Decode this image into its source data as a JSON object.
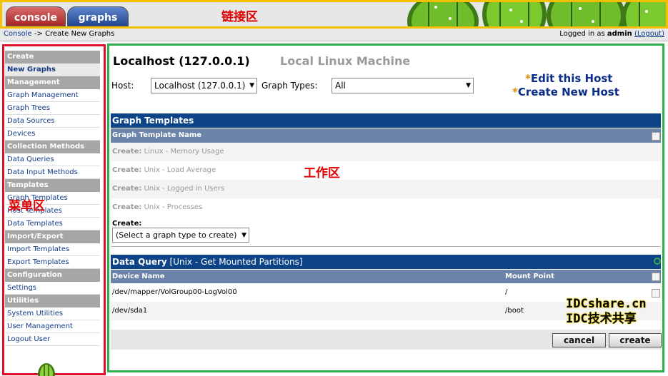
{
  "tabs": [
    {
      "label": "console"
    },
    {
      "label": "graphs"
    }
  ],
  "annotations": {
    "link_zone": "链接区",
    "menu_zone": "菜单区",
    "work_zone": "工作区"
  },
  "breadcrumb": {
    "root": "Console",
    "separator": " -> ",
    "current": "Create New Graphs"
  },
  "login": {
    "prefix": "Logged in as ",
    "user": "admin",
    "logout": "(Logout)"
  },
  "sidebar": {
    "items": [
      {
        "type": "header",
        "label": "Create"
      },
      {
        "type": "item",
        "label": "New Graphs",
        "selected": true
      },
      {
        "type": "header",
        "label": "Management"
      },
      {
        "type": "item",
        "label": "Graph Management"
      },
      {
        "type": "item",
        "label": "Graph Trees"
      },
      {
        "type": "item",
        "label": "Data Sources"
      },
      {
        "type": "item",
        "label": "Devices"
      },
      {
        "type": "header",
        "label": "Collection Methods"
      },
      {
        "type": "item",
        "label": "Data Queries"
      },
      {
        "type": "item",
        "label": "Data Input Methods"
      },
      {
        "type": "header",
        "label": "Templates"
      },
      {
        "type": "item",
        "label": "Graph Templates"
      },
      {
        "type": "item",
        "label": "Host Templates"
      },
      {
        "type": "item",
        "label": "Data Templates"
      },
      {
        "type": "header",
        "label": "Import/Export"
      },
      {
        "type": "item",
        "label": "Import Templates"
      },
      {
        "type": "item",
        "label": "Export Templates"
      },
      {
        "type": "header",
        "label": "Configuration"
      },
      {
        "type": "item",
        "label": "Settings"
      },
      {
        "type": "header",
        "label": "Utilities"
      },
      {
        "type": "item",
        "label": "System Utilities"
      },
      {
        "type": "item",
        "label": "User Management"
      },
      {
        "type": "item",
        "label": "Logout User"
      }
    ]
  },
  "host": {
    "title": "Localhost (127.0.0.1)",
    "description": "Local Linux Machine",
    "host_label": "Host:",
    "host_value": "Localhost (127.0.0.1)",
    "types_label": "Graph Types:",
    "types_value": "All",
    "edit_link": "Edit this Host",
    "create_link": "Create New Host",
    "star": "*"
  },
  "graph_templates": {
    "title": "Graph Templates",
    "column": "Graph Template Name",
    "create_prefix": "Create:",
    "rows": [
      {
        "name": "Linux - Memory Usage"
      },
      {
        "name": "Unix - Load Average"
      },
      {
        "name": "Unix - Logged in Users"
      },
      {
        "name": "Unix - Processes"
      }
    ],
    "create_label": "Create:",
    "select_value": "(Select a graph type to create)"
  },
  "data_query": {
    "title": "Data Query",
    "query_name": "[Unix - Get Mounted Partitions]",
    "columns": [
      "Device Name",
      "Mount Point"
    ],
    "rows": [
      {
        "device": "/dev/mapper/VolGroup00-LogVol00",
        "mount": "/"
      },
      {
        "device": "/dev/sda1",
        "mount": "/boot"
      }
    ]
  },
  "buttons": {
    "cancel": "cancel",
    "create": "create"
  },
  "watermark": {
    "line1": "IDCshare.cn",
    "line2": "IDC技术共享"
  },
  "colors": {
    "accent_blue": "#0d4488",
    "header_gray": "#6c84aa",
    "menu_header": "#a6a6a6"
  }
}
